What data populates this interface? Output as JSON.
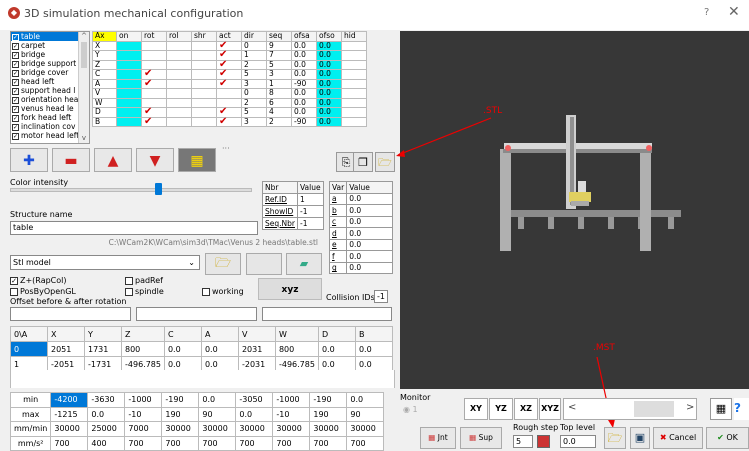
{
  "window": {
    "title": "3D simulation mechanical configuration",
    "help": "?",
    "close": "✕"
  },
  "structures": [
    "table",
    "carpet",
    "bridge",
    "bridge support",
    "bridge cover",
    "head left",
    "support head l",
    "orientation hea",
    "venus head le",
    "fork head left",
    "inclination cov",
    "motor head left"
  ],
  "axes_table": {
    "headers": [
      "Ax",
      "on",
      "rot",
      "rol",
      "shr",
      "act",
      "dir",
      "seq",
      "ofsa",
      "ofso",
      "hid"
    ],
    "rows": [
      {
        "ax": "X",
        "rot": false,
        "act": true,
        "dir": "0",
        "seq": "9",
        "ofsa": "0.0",
        "ofso": "0.0"
      },
      {
        "ax": "Y",
        "rot": false,
        "act": true,
        "dir": "1",
        "seq": "7",
        "ofsa": "0.0",
        "ofso": "0.0"
      },
      {
        "ax": "Z",
        "rot": false,
        "act": true,
        "dir": "2",
        "seq": "5",
        "ofsa": "0.0",
        "ofso": "0.0"
      },
      {
        "ax": "C",
        "rot": true,
        "act": true,
        "dir": "5",
        "seq": "3",
        "ofsa": "0.0",
        "ofso": "0.0"
      },
      {
        "ax": "A",
        "rot": true,
        "act": true,
        "dir": "3",
        "seq": "1",
        "ofsa": "-90",
        "ofso": "0.0"
      },
      {
        "ax": "V",
        "rot": false,
        "act": false,
        "dir": "0",
        "seq": "8",
        "ofsa": "0.0",
        "ofso": "0.0"
      },
      {
        "ax": "W",
        "rot": false,
        "act": false,
        "dir": "2",
        "seq": "6",
        "ofsa": "0.0",
        "ofso": "0.0"
      },
      {
        "ax": "D",
        "rot": true,
        "act": true,
        "dir": "5",
        "seq": "4",
        "ofsa": "0.0",
        "ofso": "0.0"
      },
      {
        "ax": "B",
        "rot": true,
        "act": true,
        "dir": "3",
        "seq": "2",
        "ofsa": "-90",
        "ofso": "0.0"
      }
    ]
  },
  "toolbar": {
    "more": "···"
  },
  "color_intensity": {
    "label": "Color intensity",
    "level": 0.6
  },
  "structure_name": {
    "label": "Structure name",
    "value": "table"
  },
  "path": "C:\\WCam2K\\WCam\\sim3d\\TMac\\Venus 2 heads\\table.stl",
  "nbr_table": {
    "headers": [
      "Nbr",
      "Value"
    ],
    "rows": [
      [
        "Ref.ID",
        "1"
      ],
      [
        "ShowID",
        "-1"
      ],
      [
        "Seq.Nbr",
        "-1"
      ]
    ]
  },
  "var_table": {
    "headers": [
      "Var",
      "Value"
    ],
    "rows": [
      [
        "a",
        "0.0"
      ],
      [
        "b",
        "0.0"
      ],
      [
        "c",
        "0.0"
      ],
      [
        "d",
        "0.0"
      ],
      [
        "e",
        "0.0"
      ],
      [
        "f",
        "0.0"
      ],
      [
        "g",
        "0.0"
      ]
    ]
  },
  "model_select": "Stl model",
  "options": {
    "zrap": "Z+(RapCol)",
    "posbyopengl": "PosByOpenGL",
    "padref": "padRef",
    "spindle": "spindle",
    "working": "working"
  },
  "xyz_button": "xyz",
  "collision": {
    "label": "Collision IDs",
    "value": "-1"
  },
  "offset_label": "Offset before & after rotation",
  "position_table": {
    "headers": [
      "0\\A",
      "X",
      "Y",
      "Z",
      "C",
      "A",
      "V",
      "W",
      "D",
      "B"
    ],
    "rows": [
      [
        "0",
        "2051",
        "1731",
        "800",
        "0.0",
        "0.0",
        "2031",
        "800",
        "0.0",
        "0.0"
      ],
      [
        "1",
        "-2051",
        "-1731",
        "-496.785",
        "0.0",
        "0.0",
        "-2031",
        "-496.785",
        "0.0",
        "0.0"
      ]
    ]
  },
  "limits_table": {
    "rows": [
      [
        "min",
        "-4200",
        "-3630",
        "-1000",
        "-190",
        "0.0",
        "-3050",
        "-1000",
        "-190",
        "0.0"
      ],
      [
        "max",
        "-1215",
        "0.0",
        "-10",
        "190",
        "90",
        "0.0",
        "-10",
        "190",
        "90"
      ],
      [
        "mm/min",
        "30000",
        "25000",
        "7000",
        "30000",
        "30000",
        "30000",
        "30000",
        "30000",
        "30000"
      ],
      [
        "mm/s²",
        "700",
        "400",
        "700",
        "700",
        "700",
        "700",
        "700",
        "700",
        "700"
      ]
    ]
  },
  "annotations": {
    "stl": ".STL",
    "mst": ".MST"
  },
  "monitor": {
    "label": "Monitor",
    "radio": "1"
  },
  "view_buttons": [
    "XY",
    "YZ",
    "XZ",
    "XYZ"
  ],
  "scroll": {
    "left": "<",
    "right": ">"
  },
  "bottom": {
    "jnt": "Jnt",
    "sup": "Sup",
    "rough_label": "Rough step",
    "rough_value": "5",
    "top_label": "Top level",
    "top_value": "0.0",
    "cancel": "Cancel",
    "ok": "OK",
    "cancel_glyph": "✖",
    "ok_glyph": "✔",
    "help": "?"
  },
  "colors": {
    "accent": "#0078d7",
    "cyan": "#00f0f0",
    "yellow": "#ffff00",
    "check_red": "#d00000",
    "viewport": "#373737"
  }
}
